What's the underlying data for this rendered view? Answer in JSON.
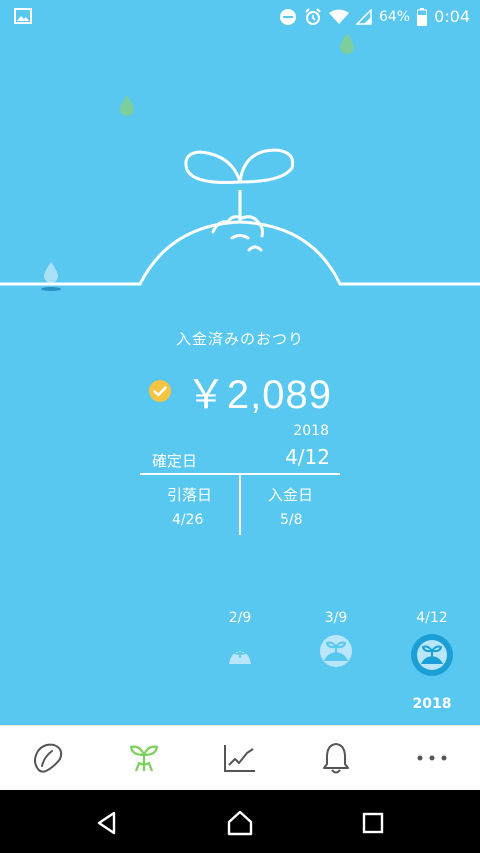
{
  "status_bar": {
    "battery_percent": "64%",
    "time": "0:04"
  },
  "summary": {
    "label": "入金済みのおつり",
    "amount": "￥2,089",
    "confirmed_year": "2018",
    "confirmed_label": "確定日",
    "confirmed_date": "4/12",
    "debit_label": "引落日",
    "debit_date": "4/26",
    "deposit_label": "入金日",
    "deposit_date": "5/8"
  },
  "timeline": {
    "items": [
      {
        "date": "2/9",
        "icon": "sprout-small-icon",
        "selected": false
      },
      {
        "date": "3/9",
        "icon": "sprout-circle-icon",
        "selected": false
      },
      {
        "date": "4/12",
        "icon": "sprout-circle-selected-icon",
        "selected": true
      }
    ],
    "year": "2018"
  },
  "bottom_nav": {
    "items": [
      "bean-icon",
      "sprout-icon",
      "chart-icon",
      "bell-icon",
      "more-icon"
    ],
    "active_index": 1
  },
  "colors": {
    "background": "#58c8f0",
    "accent_green": "#7ccf5c",
    "check_yellow": "#f4c542",
    "selected_ring": "#1b9fd6",
    "nav_icon": "#555555"
  }
}
